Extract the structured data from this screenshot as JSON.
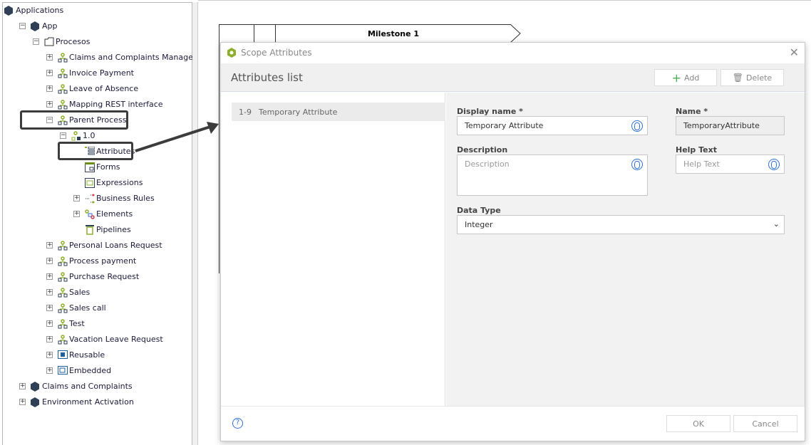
{
  "tree": [
    {
      "label": "Applications",
      "depth": 0,
      "toggle": "",
      "icon": "app-hexagon-icon"
    },
    {
      "label": "App",
      "depth": 1,
      "toggle": "-",
      "icon": "app-hexagon-icon"
    },
    {
      "label": "Procesos",
      "depth": 2,
      "toggle": "-",
      "icon": "folder-icon"
    },
    {
      "label": "Claims and Complaints Management",
      "depth": 3,
      "toggle": "+",
      "icon": "process-icon"
    },
    {
      "label": "Invoice Payment",
      "depth": 3,
      "toggle": "+",
      "icon": "process-icon"
    },
    {
      "label": "Leave of Absence",
      "depth": 3,
      "toggle": "+",
      "icon": "process-icon"
    },
    {
      "label": "Mapping REST interface",
      "depth": 3,
      "toggle": "+",
      "icon": "process-icon"
    },
    {
      "label": "Parent Process",
      "depth": 3,
      "toggle": "-",
      "icon": "process-icon"
    },
    {
      "label": "1.0",
      "depth": 4,
      "toggle": "-",
      "icon": "process-version-icon"
    },
    {
      "label": "Attributes",
      "depth": 5,
      "toggle": "",
      "icon": "attributes-icon"
    },
    {
      "label": "Forms",
      "depth": 5,
      "toggle": "",
      "icon": "forms-icon"
    },
    {
      "label": "Expressions",
      "depth": 5,
      "toggle": "",
      "icon": "expressions-icon"
    },
    {
      "label": "Business Rules",
      "depth": 5,
      "toggle": "+",
      "icon": "business-rules-icon"
    },
    {
      "label": "Elements",
      "depth": 5,
      "toggle": "+",
      "icon": "elements-icon"
    },
    {
      "label": "Pipelines",
      "depth": 5,
      "toggle": "",
      "icon": "pipelines-icon"
    },
    {
      "label": "Personal Loans Request",
      "depth": 3,
      "toggle": "+",
      "icon": "process-icon"
    },
    {
      "label": "Process payment",
      "depth": 3,
      "toggle": "+",
      "icon": "process-icon"
    },
    {
      "label": "Purchase Request",
      "depth": 3,
      "toggle": "+",
      "icon": "process-icon"
    },
    {
      "label": "Sales",
      "depth": 3,
      "toggle": "+",
      "icon": "process-icon"
    },
    {
      "label": "Sales call",
      "depth": 3,
      "toggle": "+",
      "icon": "process-icon"
    },
    {
      "label": "Test",
      "depth": 3,
      "toggle": "+",
      "icon": "process-icon"
    },
    {
      "label": "Vacation Leave Request",
      "depth": 3,
      "toggle": "+",
      "icon": "process-icon"
    },
    {
      "label": "Reusable",
      "depth": 3,
      "toggle": "+",
      "icon": "reusable-icon"
    },
    {
      "label": "Embedded",
      "depth": 3,
      "toggle": "+",
      "icon": "embedded-icon"
    },
    {
      "label": "Claims and Complaints",
      "depth": 1,
      "toggle": "+",
      "icon": "app-hexagon-icon"
    },
    {
      "label": "Environment Activation",
      "depth": 1,
      "toggle": "+",
      "icon": "app-hexagon-icon"
    }
  ],
  "canvas": {
    "milestone": "Milestone 1"
  },
  "dialog": {
    "title": "Scope Attributes",
    "list_title": "Attributes list",
    "add_label": "Add",
    "delete_label": "Delete",
    "items": [
      {
        "type": "1-9",
        "label": "Temporary Attribute"
      }
    ],
    "display_name_label": "Display name *",
    "display_name_value": "Temporary Attribute",
    "name_label": "Name *",
    "name_value": "TemporaryAttribute",
    "description_label": "Description",
    "description_placeholder": "Description",
    "help_label": "Help Text",
    "help_placeholder": "Help Text",
    "data_type_label": "Data Type",
    "data_type_value": "Integer",
    "ok_label": "OK",
    "cancel_label": "Cancel"
  },
  "colors": {
    "process_green": "#8db02b",
    "hexagon": "#2f3f55",
    "globe": "#2f6fd6"
  }
}
